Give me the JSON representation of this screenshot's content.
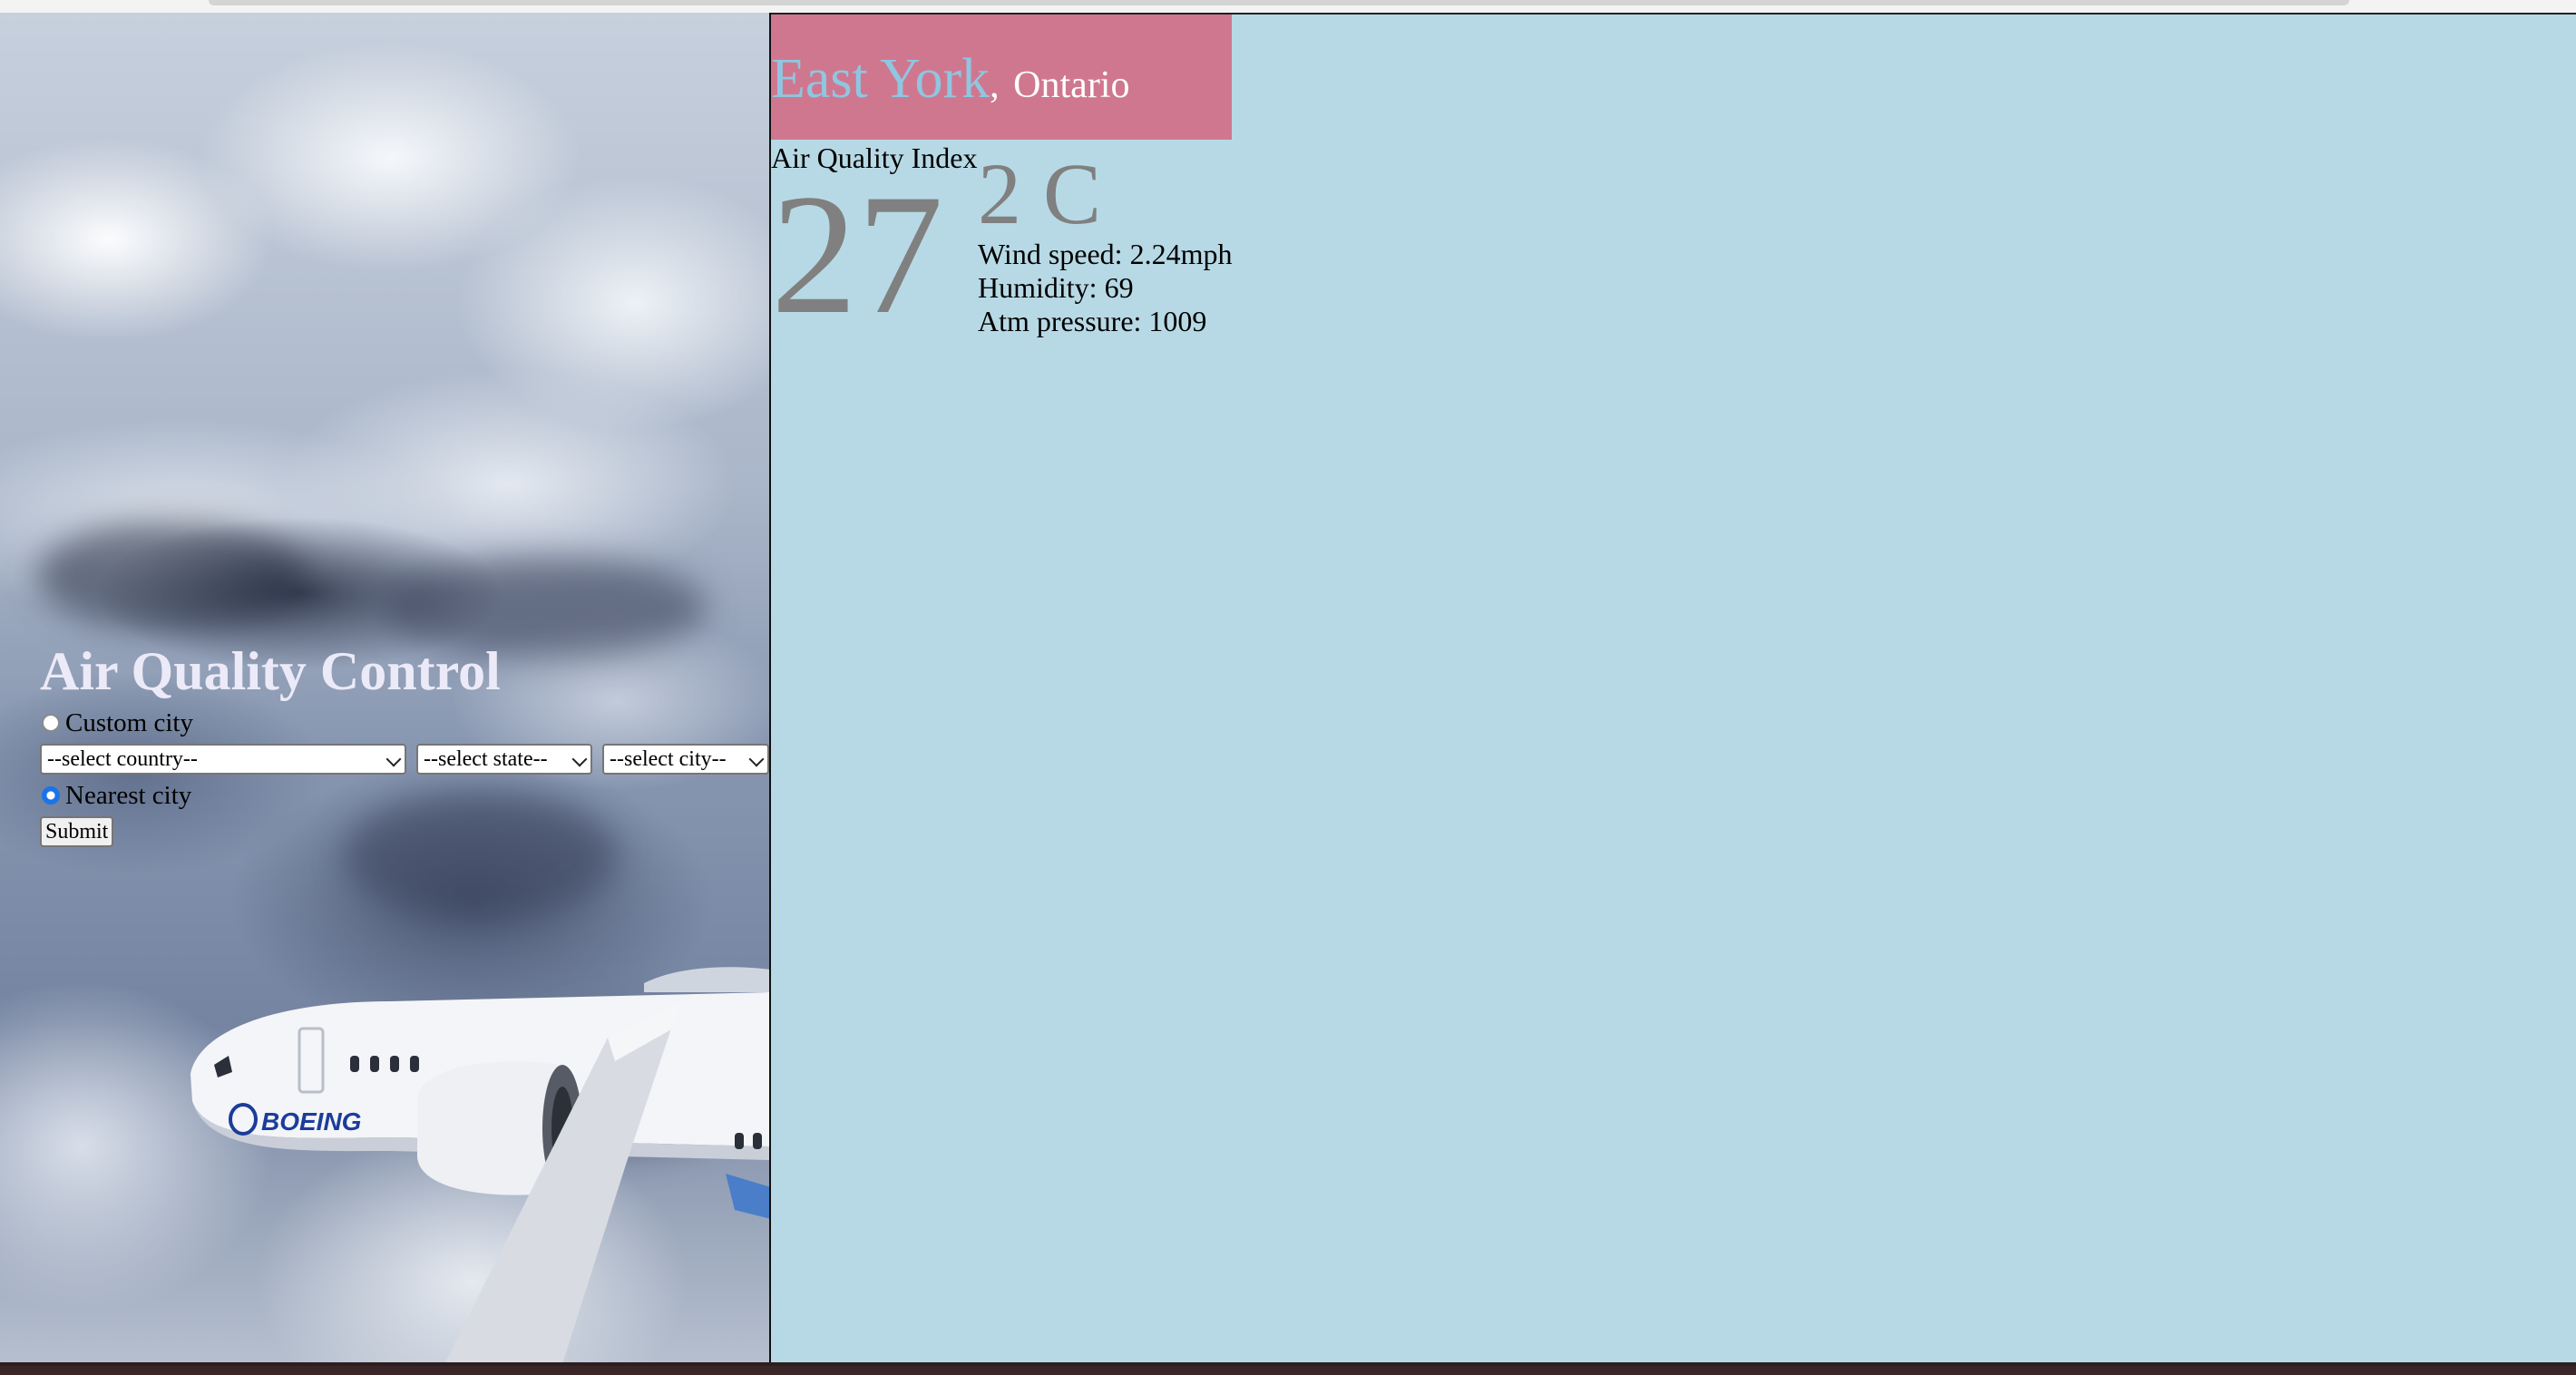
{
  "app": {
    "title": "Air Quality Control"
  },
  "form": {
    "custom_city_label": "Custom city",
    "nearest_city_label": "Nearest city",
    "selected_mode": "nearest",
    "country_select": "--select country--",
    "state_select": "--select state--",
    "city_select": "--select city--",
    "submit_label": "Submit"
  },
  "result": {
    "city": "East York",
    "separator": ",",
    "region": "Ontario",
    "aqi_label": "Air Quality Index",
    "aqi_value": "27",
    "temperature": "2 C",
    "wind_speed": "Wind speed: 2.24mph",
    "humidity": "Humidity: 69",
    "pressure": "Atm pressure: 1009"
  },
  "colors": {
    "header_bg": "#d07790",
    "city_color": "#8fc6e0",
    "panel_bg": "#b7d9e5",
    "value_gray": "#808080",
    "radio_accent": "#1a73e8"
  },
  "icons": {
    "select_arrow": "chevron-down-icon",
    "background_image": "airplane-over-clouds"
  }
}
